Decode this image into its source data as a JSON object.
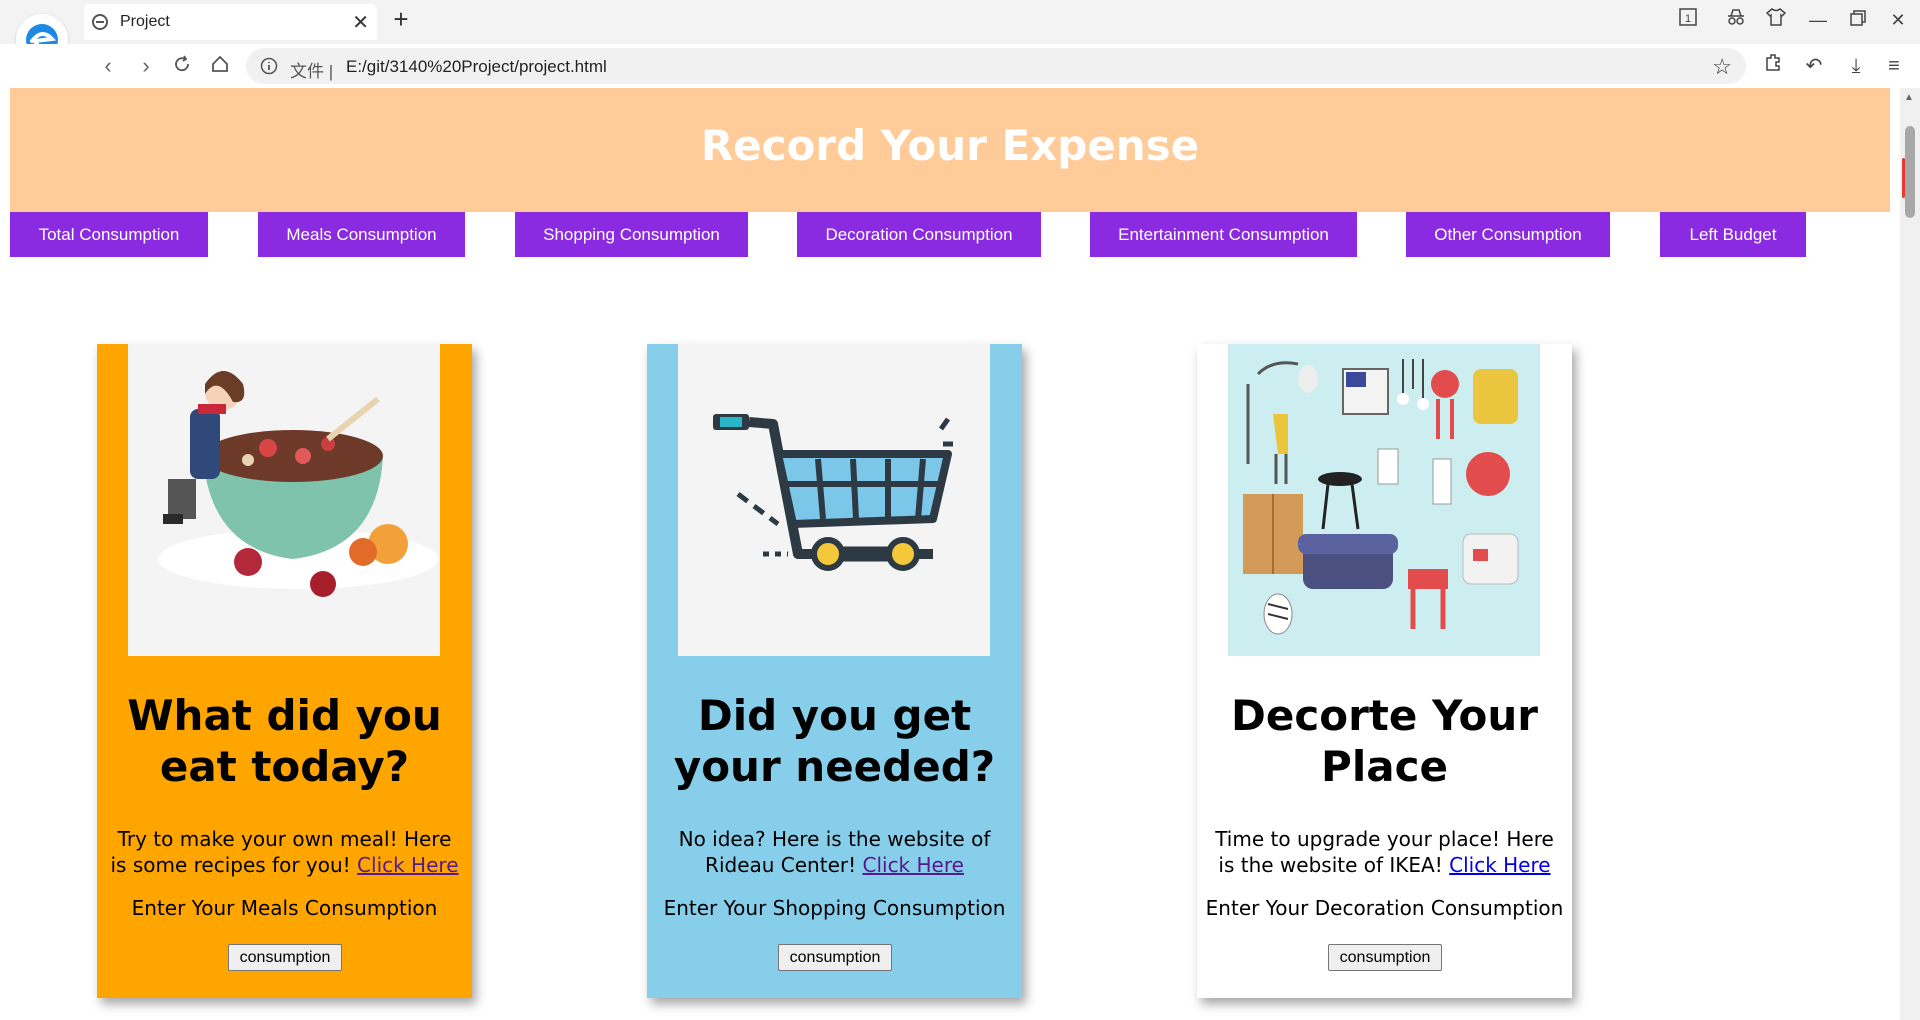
{
  "browser": {
    "tab_title": "Project",
    "url_prefix": "文件 |",
    "url": "E:/git/3140%20Project/project.html"
  },
  "header": {
    "title": "Record Your Expense"
  },
  "nav": {
    "items": [
      "Total Consumption",
      "Meals Consumption",
      "Shopping Consumption",
      "Decoration Consumption",
      "Entertainment Consumption",
      "Other Consumption",
      "Left Budget"
    ]
  },
  "cards": [
    {
      "title": "What did you eat today?",
      "desc": "Try to make your own meal! Here is some recipes for you!",
      "link": "Click Here",
      "prompt": "Enter Your Meals Consumption",
      "button": "consumption",
      "bg": "#ffa500"
    },
    {
      "title": "Did you get your needed?",
      "desc": "No idea? Here is the website of Rideau Center!",
      "link": "Click Here",
      "prompt": "Enter Your Shopping Consumption",
      "button": "consumption",
      "bg": "#87ceeb"
    },
    {
      "title": "Decorte Your Place",
      "desc": "Time to upgrade your place! Here is the website of IKEA!",
      "link": "Click Here",
      "prompt": "Enter Your Decoration Consumption",
      "button": "consumption",
      "bg": "#ffffff"
    }
  ],
  "colors": {
    "header_bg": "#fecb99",
    "nav_bg": "#8a2be2"
  }
}
